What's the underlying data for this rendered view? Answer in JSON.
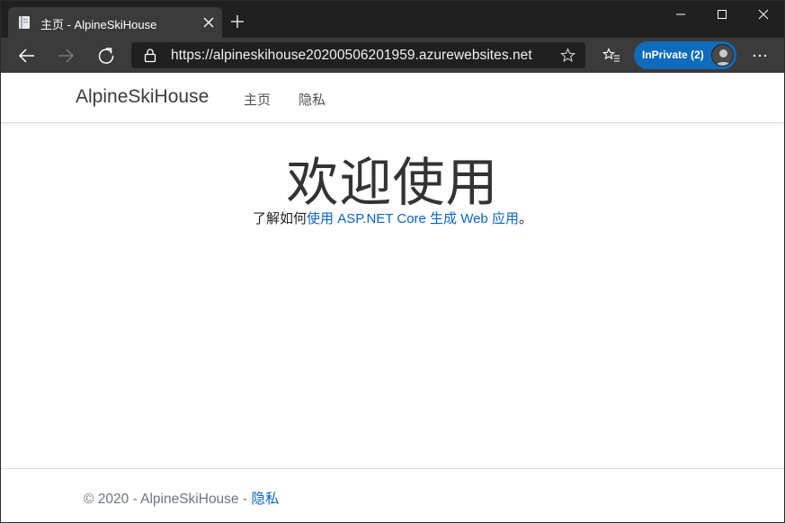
{
  "browser": {
    "tab_title": "主页 - AlpineSkiHouse",
    "url": "https://alpineskihouse20200506201959.azurewebsites.net",
    "inprivate_label": "InPrivate (2)",
    "icons": [
      "page-favicon-icon",
      "close-icon",
      "plus-icon",
      "minimize-icon",
      "maximize-icon",
      "window-close-icon",
      "back-arrow-icon",
      "forward-arrow-icon",
      "refresh-icon",
      "lock-icon",
      "star-icon",
      "favorites-icon",
      "profile-avatar",
      "more-icon"
    ],
    "colors": {
      "titlebar": "#202020",
      "toolbar": "#3b3b3b",
      "inprivate": "#0f6cbd"
    }
  },
  "site": {
    "brand": "AlpineSkiHouse",
    "nav": {
      "home": "主页",
      "privacy": "隐私"
    },
    "hero": {
      "title": "欢迎使用",
      "prefix": "了解如何",
      "link": "使用 ASP.NET Core 生成 Web 应用",
      "suffix": "。"
    },
    "footer": {
      "copyright": "© 2020 - AlpineSkiHouse - ",
      "privacy_link": "隐私"
    },
    "colors": {
      "link": "#0b63c4",
      "text": "#333333",
      "muted": "#6c757d"
    }
  }
}
